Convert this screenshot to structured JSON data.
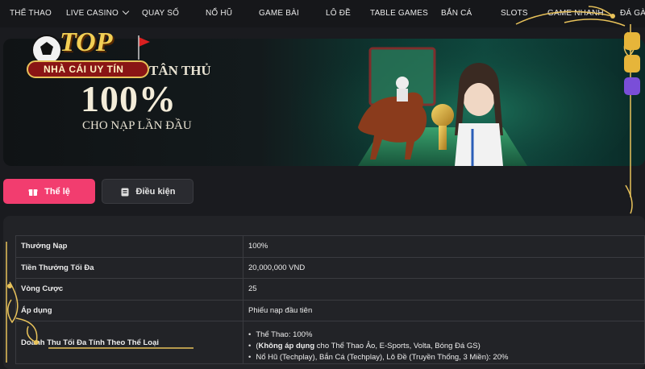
{
  "nav": {
    "items": [
      "THỂ THAO",
      "LIVE CASINO",
      "QUAY SỐ",
      "NỔ HŨ",
      "GAME BÀI",
      "LÔ ĐỀ",
      "TABLE GAMES",
      "BẮN CÁ",
      "SLOTS",
      "GAME NHANH",
      "ĐÁ GÀ"
    ]
  },
  "logo": {
    "top": "TOP",
    "tagline": "NHÀ CÁI UY TÍN"
  },
  "banner": {
    "subtitle": "MỪNG TÂN THỦ",
    "big": "100%",
    "small": "CHO NẠP LẦN ĐẦU"
  },
  "tabs": {
    "rules": "Thể lệ",
    "conditions": "Điều kiện"
  },
  "table": {
    "rows": [
      {
        "label": "Thưởng Nạp",
        "value": "100%"
      },
      {
        "label": "Tiền Thưởng Tối Đa",
        "value": "20,000,000 VND"
      },
      {
        "label": "Vòng Cược",
        "value": "25"
      },
      {
        "label": "Áp dụng",
        "value": "Phiếu nạp đầu tiên"
      }
    ],
    "last_label": "Doanh Thu Tối Đa Tính Theo Thể Loại",
    "last_items": [
      {
        "prefix": "Thể Thao: 100%",
        "bold": "",
        "rest": ""
      },
      {
        "prefix": "(",
        "bold": "Không áp dụng",
        "rest": " cho Thể Thao Ảo, E-Sports, Volta, Bóng Đá GS)"
      },
      {
        "prefix": "Nổ Hũ (Techplay), Bắn Cá (Techplay), Lô Đề (Truyền Thống, 3 Miền): 20%",
        "bold": "",
        "rest": ""
      }
    ]
  },
  "colors": {
    "accent": "#f23d6f",
    "gold": "#e8c25a",
    "dark": "#16171a"
  }
}
